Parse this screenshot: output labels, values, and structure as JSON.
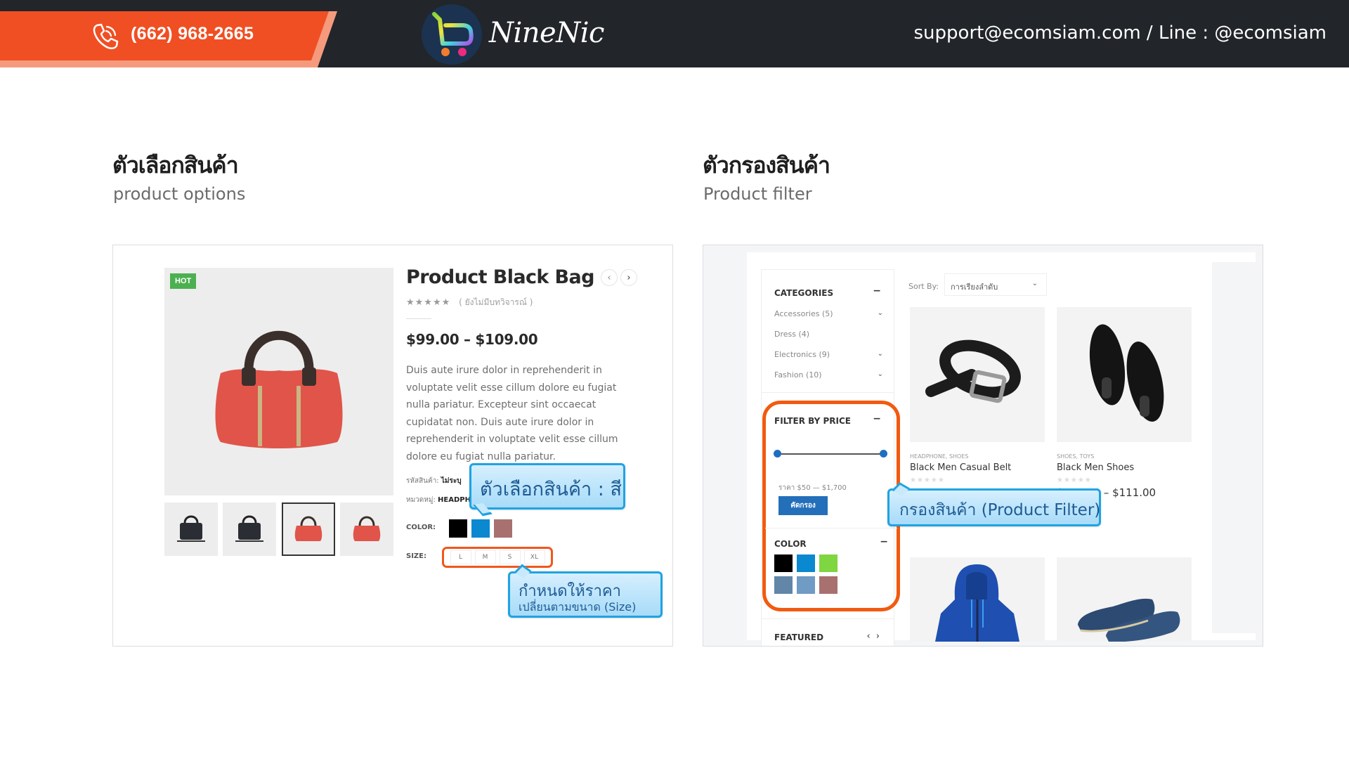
{
  "header": {
    "phone": "(662) 968-2665",
    "logo_text": "NineNic",
    "contact": "support@ecomsiam.com / Line : @ecomsiam",
    "colors": {
      "bar": "#22252a",
      "accent": "#f04f23",
      "accent_light": "#f59a7d"
    }
  },
  "sections": {
    "left": {
      "title": "ตัวเลือกสินค้า",
      "subtitle": "product options"
    },
    "right": {
      "title": "ตัวกรองสินค้า",
      "subtitle": "Product filter"
    }
  },
  "product_options": {
    "badge": "HOT",
    "title": "Product Black Bag",
    "nav_prev": "‹",
    "nav_next": "›",
    "stars": "★★★★★",
    "review_text": "( ยังไม่มีบทวิจารณ์ )",
    "price": "$99.00 – $109.00",
    "description": "Duis aute irure dolor in reprehenderit in voluptate velit esse cillum dolore eu fugiat nulla pariatur. Excepteur sint occaecat cupidatat non. Duis aute irure dolor in reprehenderit in voluptate velit esse cillum dolore eu fugiat nulla pariatur.",
    "sku_label": "รหัสสินค้า: ",
    "sku_value": "ไม่ระบุ",
    "category_label": "หมวดหมู่: ",
    "category_value": "HEADPHONE",
    "color_label": "COLOR:",
    "colors": [
      "#000000",
      "#0a88d0",
      "#a87170"
    ],
    "size_label": "SIZE:",
    "sizes": [
      "L",
      "M",
      "S",
      "XL"
    ],
    "thumbnails": [
      "black bag",
      "black bag",
      "red bag",
      "red bag"
    ],
    "active_thumbnail": 2,
    "callout_color": "ตัวเลือกสินค้า : สี",
    "callout_size_line1": "กำหนดให้ราคา",
    "callout_size_line2": "เปลี่ยนตามขนาด (Size)"
  },
  "product_filter": {
    "categories_title": "CATEGORIES",
    "categories": [
      {
        "label": "Accessories (5)",
        "expandable": true
      },
      {
        "label": "Dress (4)",
        "expandable": false
      },
      {
        "label": "Electronics (9)",
        "expandable": true
      },
      {
        "label": "Fashion (10)",
        "expandable": true
      }
    ],
    "price_title": "FILTER BY PRICE",
    "price_range_text": "ราคา $50 — $1,700",
    "price_min": 50,
    "price_max": 1700,
    "filter_button": "คัดกรอง",
    "color_title": "COLOR",
    "colors": [
      "#000000",
      "#0a88d0",
      "#7fd640",
      "#6186a8",
      "#6f9bc4",
      "#a87170"
    ],
    "featured_title": "FEATURED",
    "featured_arrows": "‹ ›",
    "minus": "−",
    "sort_label": "Sort By:",
    "sort_value": "การเรียงลำดับ",
    "products": [
      {
        "cats": "HEADPHONE, SHOES",
        "name": "Black Men Casual Belt",
        "stars": "★★★★★",
        "price": "",
        "image": "belt"
      },
      {
        "cats": "SHOES, TOYS",
        "name": "Black Men Shoes",
        "stars": "★★★★★",
        "price": "$105.00 – $111.00",
        "image": "sneakers"
      },
      {
        "cats": "",
        "name": "",
        "stars": "",
        "price": "",
        "image": "hoodie"
      },
      {
        "cats": "",
        "name": "",
        "stars": "",
        "price": "",
        "image": "dress-shoes"
      }
    ],
    "callout_filter": "กรองสินค้า (Product Filter)"
  }
}
